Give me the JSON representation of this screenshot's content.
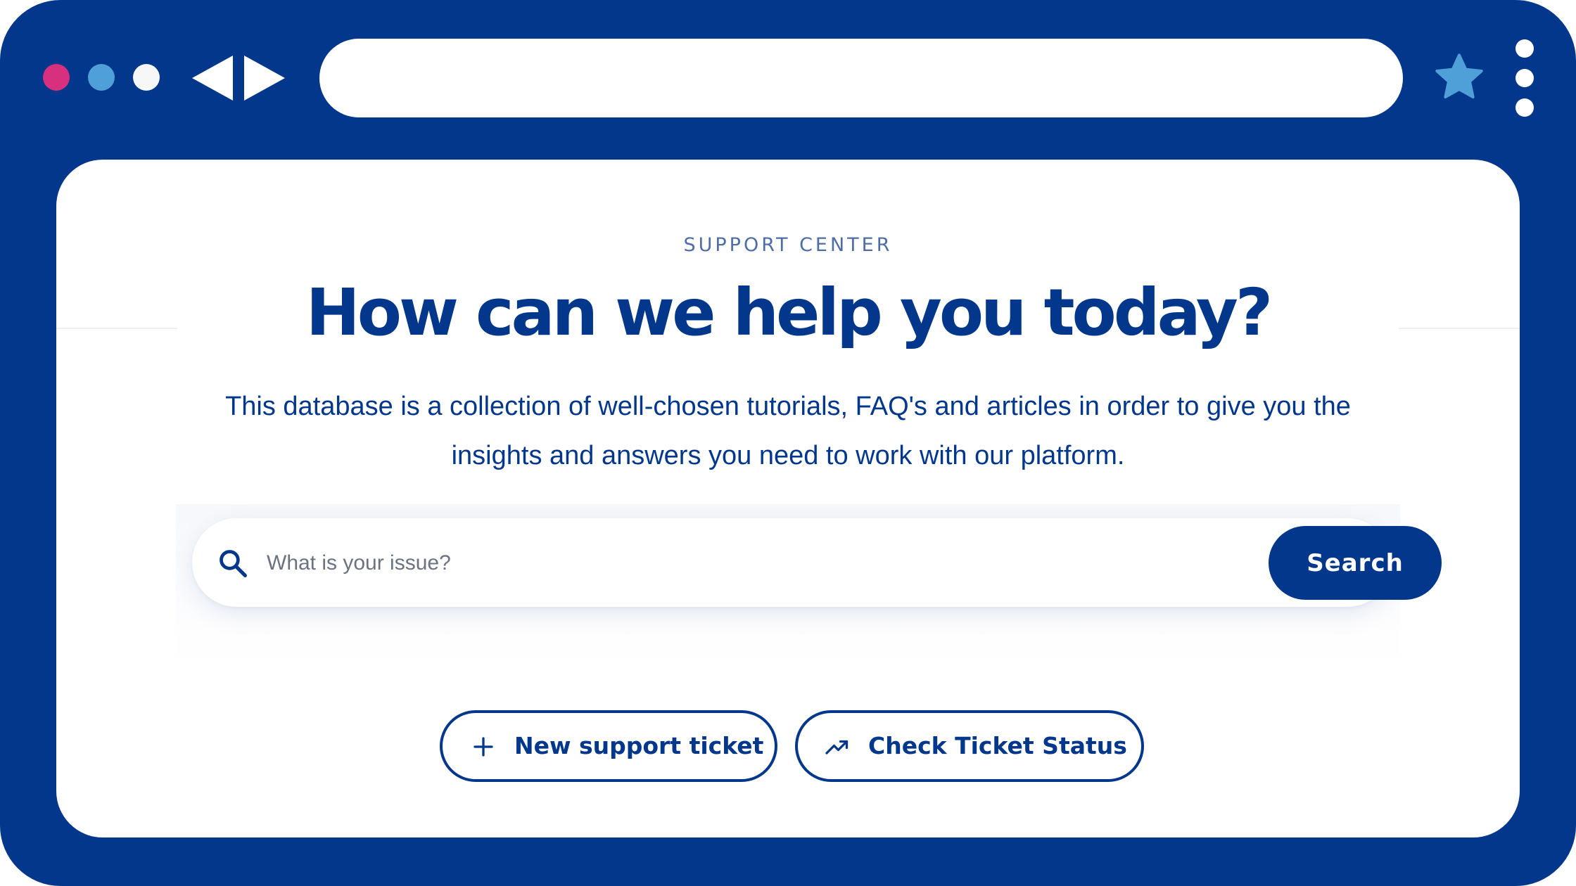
{
  "browser": {
    "window_controls": [
      "close-dot",
      "minimize-dot",
      "maximize-dot"
    ],
    "address_bar_value": "",
    "icons": {
      "back": "triangle-left-icon",
      "forward": "triangle-right-icon",
      "bookmark": "star-icon",
      "menu": "kebab-menu-icon"
    },
    "colors": {
      "frame": "#02378B",
      "close_dot": "#D6307E",
      "minimize_dot": "#4FA0D8",
      "maximize_dot": "#F7F7F7",
      "star": "#4FA0D8"
    }
  },
  "hero": {
    "eyebrow": "SUPPORT CENTER",
    "title": "How can we help you today?",
    "intro_line_1": "This database is a collection of well-chosen tutorials, FAQ's and articles in order to give you the",
    "intro_line_2": "insights and answers you need to work with our platform."
  },
  "search": {
    "icon": "search-icon",
    "placeholder": "What is your issue?",
    "value": "",
    "button_label": "Search"
  },
  "actions": [
    {
      "icon": "plus-icon",
      "label": "New support ticket"
    },
    {
      "icon": "trending-up-icon",
      "label": "Check Ticket Status"
    }
  ],
  "theme": {
    "primary": "#02378B",
    "eyebrow_color": "#4E6DA6",
    "placeholder_color": "#6B7280"
  }
}
